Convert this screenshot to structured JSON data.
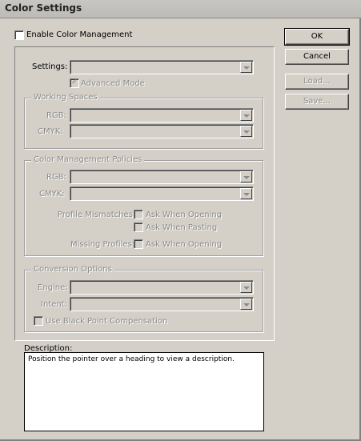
{
  "window": {
    "title": "Color Settings"
  },
  "enable_cms": {
    "label": "Enable Color Management",
    "checked": false
  },
  "settings": {
    "label": "Settings:",
    "value": "",
    "advanced_mode_label": "Advanced Mode",
    "advanced_mode_checked": true
  },
  "working_spaces": {
    "title": "Working Spaces",
    "rgb_label": "RGB:",
    "rgb_value": "",
    "cmyk_label": "CMYK:",
    "cmyk_value": ""
  },
  "policies": {
    "title": "Color Management Policies",
    "rgb_label": "RGB:",
    "rgb_value": "",
    "cmyk_label": "CMYK:",
    "cmyk_value": "",
    "profile_mismatches_label": "Profile Mismatches:",
    "ask_when_opening_label": "Ask When Opening",
    "ask_when_pasting_label": "Ask When Pasting",
    "missing_profiles_label": "Missing Profiles:",
    "missing_ask_when_opening_label": "Ask When Opening"
  },
  "conversion": {
    "title": "Conversion Options",
    "engine_label": "Engine:",
    "engine_value": "",
    "intent_label": "Intent:",
    "intent_value": "",
    "black_point_label": "Use Black Point Compensation"
  },
  "description": {
    "label": "Description:",
    "text": "Position the pointer over a heading to view a description."
  },
  "buttons": {
    "ok": "OK",
    "cancel": "Cancel",
    "load": "Load...",
    "save": "Save..."
  }
}
